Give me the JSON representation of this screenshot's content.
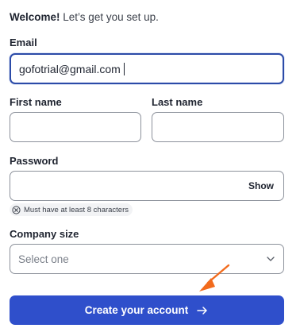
{
  "welcome": {
    "bold": "Welcome!",
    "rest": " Let’s get you set up."
  },
  "email": {
    "label": "Email",
    "value": "gofotrial@gmail.com"
  },
  "first_name": {
    "label": "First name",
    "value": ""
  },
  "last_name": {
    "label": "Last name",
    "value": ""
  },
  "password": {
    "label": "Password",
    "value": "",
    "show_label": "Show",
    "hint": "Must have at least 8 characters"
  },
  "company_size": {
    "label": "Company size",
    "placeholder": "Select one"
  },
  "submit": {
    "label": "Create your account"
  },
  "icons": {
    "hint": "circle-x-icon",
    "select": "chevron-down-icon",
    "submit": "arrow-right-icon",
    "annotation": "orange-pointer-arrow"
  },
  "colors": {
    "accent": "#2f4fcb",
    "focus_border": "#2c4ba8",
    "annotation": "#f26b1d"
  }
}
